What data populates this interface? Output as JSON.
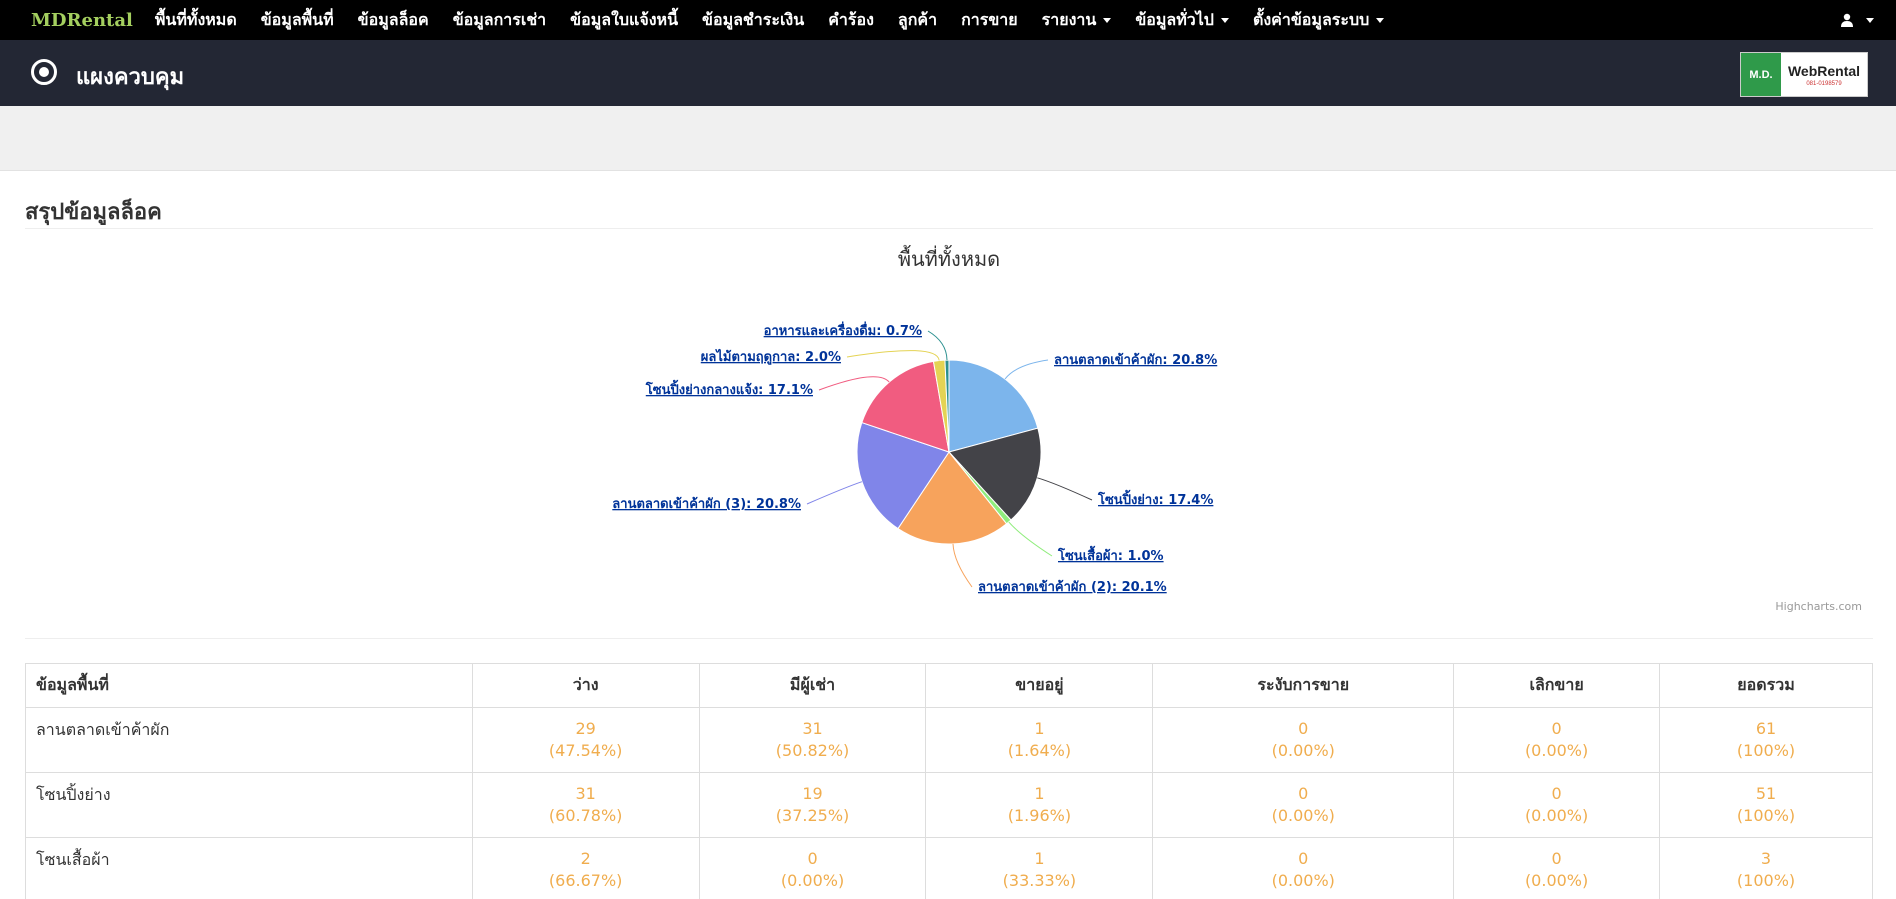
{
  "nav": {
    "brand": "MDRental",
    "items": [
      {
        "label": "พื้นที่ทั้งหมด",
        "dropdown": false
      },
      {
        "label": "ข้อมูลพื้นที่",
        "dropdown": false
      },
      {
        "label": "ข้อมูลล็อค",
        "dropdown": false
      },
      {
        "label": "ข้อมูลการเช่า",
        "dropdown": false
      },
      {
        "label": "ข้อมูลใบแจ้งหนี้",
        "dropdown": false
      },
      {
        "label": "ข้อมูลชำระเงิน",
        "dropdown": false
      },
      {
        "label": "คำร้อง",
        "dropdown": false
      },
      {
        "label": "ลูกค้า",
        "dropdown": false
      },
      {
        "label": "การขาย",
        "dropdown": false
      },
      {
        "label": "รายงาน",
        "dropdown": true
      },
      {
        "label": "ข้อมูลทั่วไป",
        "dropdown": true
      },
      {
        "label": "ตั้งค่าข้อมูลระบบ",
        "dropdown": true
      }
    ],
    "user_icon": "user-icon"
  },
  "header": {
    "title": "แผงควบคุม",
    "icon": "target-icon",
    "logo_left": "M.D.",
    "logo_main": "WebRental",
    "logo_sub": "081-0198579"
  },
  "section": {
    "title": "สรุปข้อมูลล็อค"
  },
  "chart_data": {
    "type": "pie",
    "title": "พื้นที่ทั้งหมด",
    "credits": "Highcharts.com",
    "series": [
      {
        "name": "ลานตลาดเข้าค้าผัก",
        "value": 20.8,
        "color": "#7cb5ec"
      },
      {
        "name": "โซนปิ้งย่าง",
        "value": 17.4,
        "color": "#434348"
      },
      {
        "name": "โซนเสื้อผ้า",
        "value": 1.0,
        "color": "#90ed7d"
      },
      {
        "name": "ลานตลาดเข้าค้าผัก (2)",
        "value": 20.1,
        "color": "#f7a35c"
      },
      {
        "name": "ลานตลาดเข้าค้าผัก (3)",
        "value": 20.8,
        "color": "#8085e9"
      },
      {
        "name": "โซนปิ้งย่างกลางแจ้ง",
        "value": 17.1,
        "color": "#f15c80"
      },
      {
        "name": "ผลไม้ตามฤดูกาล",
        "value": 2.0,
        "color": "#e4d354"
      },
      {
        "name": "อาหารและเครื่องดื่ม",
        "value": 0.7,
        "color": "#2b908f"
      }
    ],
    "label_color": "#003399"
  },
  "table": {
    "headers": [
      "ข้อมูลพื้นที่",
      "ว่าง",
      "มีผู้เช่า",
      "ขายอยู่",
      "ระงับการขาย",
      "เลิกขาย",
      "ยอดรวม"
    ],
    "rows": [
      {
        "name": "ลานตลาดเข้าค้าผัก",
        "cells": [
          [
            "29",
            "(47.54%)"
          ],
          [
            "31",
            "(50.82%)"
          ],
          [
            "1",
            "(1.64%)"
          ],
          [
            "0",
            "(0.00%)"
          ],
          [
            "0",
            "(0.00%)"
          ],
          [
            "61",
            "(100%)"
          ]
        ]
      },
      {
        "name": "โซนปิ้งย่าง",
        "cells": [
          [
            "31",
            "(60.78%)"
          ],
          [
            "19",
            "(37.25%)"
          ],
          [
            "1",
            "(1.96%)"
          ],
          [
            "0",
            "(0.00%)"
          ],
          [
            "0",
            "(0.00%)"
          ],
          [
            "51",
            "(100%)"
          ]
        ]
      },
      {
        "name": "โซนเสื้อผ้า",
        "cells": [
          [
            "2",
            "(66.67%)"
          ],
          [
            "0",
            "(0.00%)"
          ],
          [
            "1",
            "(33.33%)"
          ],
          [
            "0",
            "(0.00%)"
          ],
          [
            "0",
            "(0.00%)"
          ],
          [
            "3",
            "(100%)"
          ]
        ]
      }
    ]
  }
}
